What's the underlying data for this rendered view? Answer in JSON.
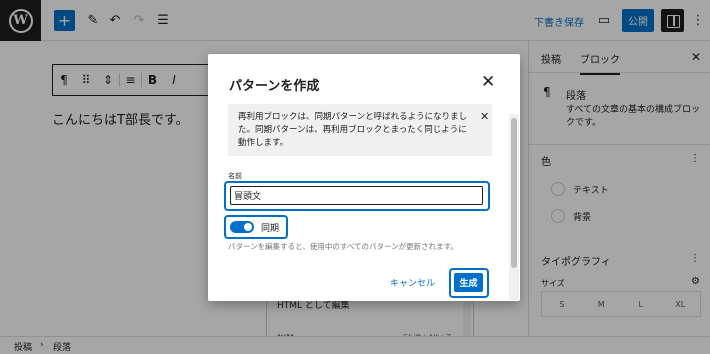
{
  "topbar": {
    "logo": "W",
    "add_icon": "+",
    "pen_icon": "✎",
    "undo_icon": "↶",
    "redo_icon": "↷",
    "list_icon": "☰",
    "draft_label": "下書き保存",
    "preview_icon": "▭",
    "publish_label": "公開",
    "more_icon": "⋮"
  },
  "toolbar": {
    "paragraph_icon": "¶",
    "drag_icon": "⠿",
    "move_icon": "⇕",
    "align_icon": "≡",
    "bold_label": "B",
    "italic_label": "I"
  },
  "canvas": {
    "content": "こんにちはT部長です。",
    "menu_item_1": "HTML として編集",
    "menu_item_2": "削除",
    "menu_shortcut_2": "Shift+Alt+Z"
  },
  "sidebar": {
    "tab_post": "投稿",
    "tab_block": "ブロック",
    "close_icon": "✕",
    "block_icon": "¶",
    "block_name": "段落",
    "block_desc": "すべての文章の基本の構成ブロックです。",
    "color_title": "色",
    "color_text": "テキスト",
    "color_background": "背景",
    "typography_title": "タイポグラフィ",
    "size_label": "サイズ",
    "sizes": [
      "S",
      "M",
      "L",
      "XL"
    ],
    "dots_icon": "⋮",
    "sliders_icon": "⚙"
  },
  "statusbar": {
    "crumb_1": "投稿",
    "separator": "›",
    "crumb_2": "段落"
  },
  "modal": {
    "title": "パターンを作成",
    "close_icon": "✕",
    "notice": "再利用ブロックは、同期パターンと呼ばれるようになりました。同期パターンは、再利用ブロックとまったく同じように動作します。",
    "notice_close": "✕",
    "name_label": "名前",
    "name_value": "冒頭文",
    "sync_label": "同期",
    "help_text": "パターンを編集すると、使用中のすべてのパターンが更新されます。",
    "cancel_label": "キャンセル",
    "create_label": "生成"
  }
}
